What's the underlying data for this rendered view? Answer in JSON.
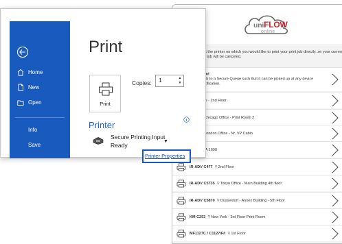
{
  "uniflow": {
    "logo": {
      "brand_uni": "uni",
      "brand_flow": "FLOW",
      "subtitle": "online"
    },
    "instructions": "elect the printer on which you would like to print your print job directly. se your current print job will be canceled.",
    "secure_option": {
      "title": "rint",
      "description": "job to a Secure Queue such that it can be picked up at any device ntification."
    },
    "printers": [
      {
        "model": "",
        "location": "IT Office - 2nd Floor"
      },
      {
        "model": "C3325",
        "location": "Chicago Office - Print Room 2"
      },
      {
        "model": "C3725",
        "location": "London Office - Nr. VP Cabin"
      },
      {
        "model": "C3725",
        "location": "IA 1690"
      },
      {
        "model": "iR-ADV C477",
        "location": "2nd Floor"
      },
      {
        "model": "iR-ADV C5735",
        "location": "Tokyo Office - Main Building 4th floor"
      },
      {
        "model": "iR-ADV C5870",
        "location": "Düsseldorf - Annex Building - 5th Floor"
      },
      {
        "model": "KM C253",
        "location": "New York - 3rd Floor Print Room"
      },
      {
        "model": "MF1127C / C1127iF/i",
        "location": "1st Floor"
      }
    ]
  },
  "word": {
    "nav": {
      "home": "Home",
      "new": "New",
      "open": "Open",
      "info": "Info",
      "save": "Save"
    },
    "title": "Print",
    "print_button": "Print",
    "copies_label": "Copies:",
    "copies_value": "1",
    "printer_heading": "Printer",
    "printer_name": "Secure Printing Input",
    "printer_status": "Ready",
    "printer_properties": "Printer Properties"
  }
}
